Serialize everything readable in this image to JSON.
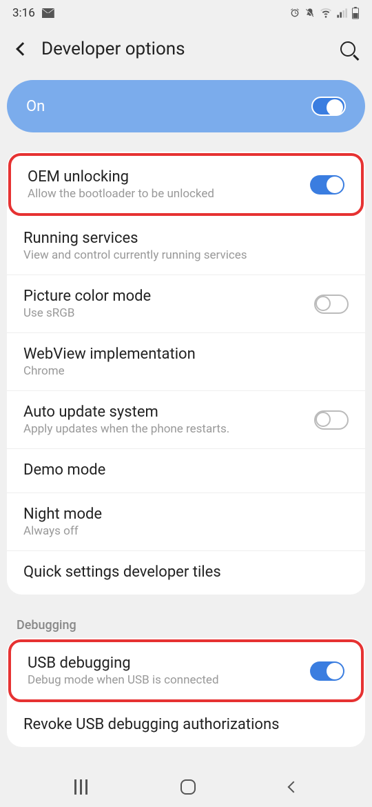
{
  "status": {
    "time": "3:16",
    "icons": {
      "email": "email-icon",
      "alarm": "⏰",
      "mute": "🔇",
      "wifi": "📶",
      "signal": "▁",
      "battery": "🔋"
    }
  },
  "header": {
    "title": "Developer options"
  },
  "masterToggle": {
    "label": "On",
    "enabled": true
  },
  "sections": [
    {
      "items": [
        {
          "title": "OEM unlocking",
          "subtitle": "Allow the bootloader to be unlocked",
          "toggle": true,
          "toggleOn": true,
          "highlighted": true
        },
        {
          "title": "Running services",
          "subtitle": "View and control currently running services"
        },
        {
          "title": "Picture color mode",
          "subtitle": "Use sRGB",
          "toggle": true,
          "toggleOn": false
        },
        {
          "title": "WebView implementation",
          "subtitle": "Chrome"
        },
        {
          "title": "Auto update system",
          "subtitle": "Apply updates when the phone restarts.",
          "toggle": true,
          "toggleOn": false
        },
        {
          "title": "Demo mode"
        },
        {
          "title": "Night mode",
          "subtitle": "Always off"
        },
        {
          "title": "Quick settings developer tiles"
        }
      ]
    },
    {
      "header": "Debugging",
      "items": [
        {
          "title": "USB debugging",
          "subtitle": "Debug mode when USB is connected",
          "toggle": true,
          "toggleOn": true,
          "highlighted": true
        },
        {
          "title": "Revoke USB debugging authorizations"
        }
      ]
    }
  ]
}
